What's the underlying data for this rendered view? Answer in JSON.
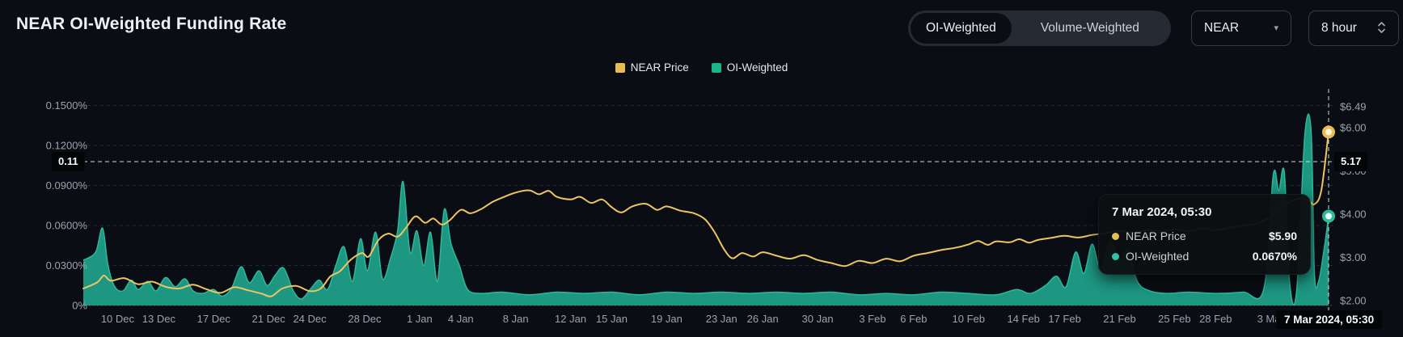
{
  "header": {
    "title": "NEAR OI-Weighted Funding Rate"
  },
  "controls": {
    "mode_toggle": {
      "options": [
        {
          "label": "OI-Weighted",
          "active": true
        },
        {
          "label": "Volume-Weighted",
          "active": false
        }
      ]
    },
    "symbol_select": {
      "value": "NEAR"
    },
    "interval_select": {
      "value": "8 hour"
    }
  },
  "legend": [
    {
      "label": "NEAR Price",
      "color": "#e9bc52"
    },
    {
      "label": "OI-Weighted",
      "color": "#19b585"
    }
  ],
  "crosshair": {
    "left_label": "0.11",
    "right_label": "5.17",
    "date_label": "7 Mar 2024, 05:30"
  },
  "tooltip": {
    "date": "7 Mar 2024, 05:30",
    "rows": [
      {
        "label": "NEAR Price",
        "value": "$5.90",
        "color": "#e5bd58"
      },
      {
        "label": "OI-Weighted",
        "value": "0.0670%",
        "color": "#35c2a4"
      }
    ]
  },
  "chart_data": {
    "type": "area+line",
    "t_unit": "days since 8 Dec 00:00; end of domain = 7 Mar 2024 05:30",
    "t_domain": [
      -0.5,
      90.23
    ],
    "left_axis": {
      "label": "OI-Weighted funding rate",
      "range": [
        0,
        0.15
      ],
      "ticks": [
        {
          "v": 0.15,
          "label": "0.1500%"
        },
        {
          "v": 0.12,
          "label": "0.1200%"
        },
        {
          "v": 0.09,
          "label": "0.0900%"
        },
        {
          "v": 0.06,
          "label": "0.0600%"
        },
        {
          "v": 0.03,
          "label": "0.0300%"
        },
        {
          "v": 0,
          "label": "0%"
        }
      ]
    },
    "right_axis": {
      "label": "NEAR price (USD)",
      "range": [
        2,
        6.49
      ],
      "ticks": [
        {
          "v": 6.49,
          "label": "$6.49"
        },
        {
          "v": 6.0,
          "label": "$6.00"
        },
        {
          "v": 5.0,
          "label": "$5.00"
        },
        {
          "v": 4.0,
          "label": "$4.00"
        },
        {
          "v": 3.0,
          "label": "$3.00"
        },
        {
          "v": 2.0,
          "label": "$2.00"
        }
      ]
    },
    "x_ticks": [
      {
        "t": 2,
        "label": "10 Dec"
      },
      {
        "t": 5,
        "label": "13 Dec"
      },
      {
        "t": 9,
        "label": "17 Dec"
      },
      {
        "t": 13,
        "label": "21 Dec"
      },
      {
        "t": 16,
        "label": "24 Dec"
      },
      {
        "t": 20,
        "label": "28 Dec"
      },
      {
        "t": 24,
        "label": "1 Jan"
      },
      {
        "t": 27,
        "label": "4 Jan"
      },
      {
        "t": 31,
        "label": "8 Jan"
      },
      {
        "t": 35,
        "label": "12 Jan"
      },
      {
        "t": 38,
        "label": "15 Jan"
      },
      {
        "t": 42,
        "label": "19 Jan"
      },
      {
        "t": 46,
        "label": "23 Jan"
      },
      {
        "t": 49,
        "label": "26 Jan"
      },
      {
        "t": 53,
        "label": "30 Jan"
      },
      {
        "t": 57,
        "label": "3 Feb"
      },
      {
        "t": 60,
        "label": "6 Feb"
      },
      {
        "t": 64,
        "label": "10 Feb"
      },
      {
        "t": 68,
        "label": "14 Feb"
      },
      {
        "t": 71,
        "label": "17 Feb"
      },
      {
        "t": 75,
        "label": "21 Feb"
      },
      {
        "t": 79,
        "label": "25 Feb"
      },
      {
        "t": 82,
        "label": "28 Feb"
      },
      {
        "t": 86,
        "label": "3 Mar"
      }
    ],
    "series": [
      {
        "name": "OI-Weighted",
        "type": "area",
        "axis": "left",
        "fill": "#1f9e88",
        "stroke": "#2db89b",
        "points": [
          [
            -0.5,
            0.034
          ],
          [
            0.4,
            0.04
          ],
          [
            0.9,
            0.058
          ],
          [
            1.3,
            0.03
          ],
          [
            1.8,
            0.014
          ],
          [
            2.4,
            0.011
          ],
          [
            3,
            0.019
          ],
          [
            3.5,
            0.012
          ],
          [
            4.2,
            0.018
          ],
          [
            4.8,
            0.011
          ],
          [
            5.5,
            0.021
          ],
          [
            6.2,
            0.014
          ],
          [
            6.9,
            0.02
          ],
          [
            7.5,
            0.011
          ],
          [
            8.2,
            0.009
          ],
          [
            9,
            0.012
          ],
          [
            9.6,
            0.007
          ],
          [
            10.3,
            0.013
          ],
          [
            11,
            0.029
          ],
          [
            11.6,
            0.017
          ],
          [
            12.3,
            0.026
          ],
          [
            12.9,
            0.015
          ],
          [
            13.5,
            0.023
          ],
          [
            14.1,
            0.028
          ],
          [
            14.8,
            0.011
          ],
          [
            15.4,
            0.005
          ],
          [
            16.1,
            0.013
          ],
          [
            16.7,
            0.019
          ],
          [
            17.3,
            0.012
          ],
          [
            17.9,
            0.03
          ],
          [
            18.5,
            0.044
          ],
          [
            19.1,
            0.018
          ],
          [
            19.7,
            0.05
          ],
          [
            20.2,
            0.026
          ],
          [
            20.8,
            0.055
          ],
          [
            21.3,
            0.02
          ],
          [
            21.9,
            0.036
          ],
          [
            22.4,
            0.056
          ],
          [
            22.8,
            0.093
          ],
          [
            23.3,
            0.04
          ],
          [
            23.8,
            0.056
          ],
          [
            24.3,
            0.03
          ],
          [
            24.8,
            0.055
          ],
          [
            25.3,
            0.018
          ],
          [
            25.8,
            0.072
          ],
          [
            26.3,
            0.046
          ],
          [
            26.9,
            0.03
          ],
          [
            27.5,
            0.012
          ],
          [
            28.5,
            0.009
          ],
          [
            30,
            0.01
          ],
          [
            32,
            0.008
          ],
          [
            34,
            0.01
          ],
          [
            36,
            0.009
          ],
          [
            38,
            0.01
          ],
          [
            40,
            0.008
          ],
          [
            42,
            0.01
          ],
          [
            44,
            0.009
          ],
          [
            46,
            0.01
          ],
          [
            48,
            0.009
          ],
          [
            50,
            0.01
          ],
          [
            52,
            0.009
          ],
          [
            54,
            0.01
          ],
          [
            56,
            0.008
          ],
          [
            58,
            0.009
          ],
          [
            60,
            0.008
          ],
          [
            62,
            0.01
          ],
          [
            64,
            0.009
          ],
          [
            66,
            0.008
          ],
          [
            67.5,
            0.012
          ],
          [
            68.5,
            0.009
          ],
          [
            69.6,
            0.015
          ],
          [
            70.4,
            0.022
          ],
          [
            71.1,
            0.014
          ],
          [
            71.8,
            0.04
          ],
          [
            72.4,
            0.024
          ],
          [
            73,
            0.046
          ],
          [
            73.6,
            0.028
          ],
          [
            74.3,
            0.048
          ],
          [
            75,
            0.034
          ],
          [
            75.6,
            0.042
          ],
          [
            76.3,
            0.018
          ],
          [
            77.2,
            0.011
          ],
          [
            78.5,
            0.009
          ],
          [
            80,
            0.01
          ],
          [
            82,
            0.009
          ],
          [
            84,
            0.01
          ],
          [
            85.5,
            0.012
          ],
          [
            86.2,
            0.098
          ],
          [
            86.6,
            0.086
          ],
          [
            87,
            0.1
          ],
          [
            87.4,
            0.016
          ],
          [
            87.9,
            0.011
          ],
          [
            88.5,
            0.128
          ],
          [
            88.95,
            0.131
          ],
          [
            89.2,
            0.024
          ],
          [
            89.5,
            0.018
          ],
          [
            89.9,
            0.042
          ],
          [
            90.23,
            0.067
          ]
        ]
      },
      {
        "name": "NEAR Price",
        "type": "line",
        "axis": "right",
        "stroke": "#edc463",
        "points": [
          [
            -0.5,
            2.28
          ],
          [
            0.5,
            2.42
          ],
          [
            1,
            2.58
          ],
          [
            1.5,
            2.46
          ],
          [
            2.5,
            2.52
          ],
          [
            3.5,
            2.38
          ],
          [
            4.5,
            2.44
          ],
          [
            5.5,
            2.32
          ],
          [
            6.5,
            2.28
          ],
          [
            7.5,
            2.37
          ],
          [
            8.5,
            2.26
          ],
          [
            9.5,
            2.18
          ],
          [
            10.5,
            2.31
          ],
          [
            11.5,
            2.24
          ],
          [
            12.5,
            2.16
          ],
          [
            13.2,
            2.1
          ],
          [
            14,
            2.28
          ],
          [
            15,
            2.34
          ],
          [
            16,
            2.22
          ],
          [
            16.8,
            2.28
          ],
          [
            17.5,
            2.56
          ],
          [
            18.2,
            2.68
          ],
          [
            19,
            2.95
          ],
          [
            19.8,
            3.1
          ],
          [
            20.3,
            3.02
          ],
          [
            21,
            3.4
          ],
          [
            21.7,
            3.55
          ],
          [
            22.4,
            3.48
          ],
          [
            23,
            3.68
          ],
          [
            23.7,
            3.95
          ],
          [
            24.4,
            3.8
          ],
          [
            25,
            3.9
          ],
          [
            25.6,
            3.76
          ],
          [
            26.2,
            3.86
          ],
          [
            27,
            4.1
          ],
          [
            27.7,
            4.02
          ],
          [
            28.5,
            4.12
          ],
          [
            29.3,
            4.28
          ],
          [
            30,
            4.38
          ],
          [
            31,
            4.5
          ],
          [
            32,
            4.55
          ],
          [
            32.7,
            4.46
          ],
          [
            33.4,
            4.54
          ],
          [
            34,
            4.4
          ],
          [
            35,
            4.34
          ],
          [
            35.7,
            4.4
          ],
          [
            36.5,
            4.26
          ],
          [
            37.3,
            4.34
          ],
          [
            38,
            4.16
          ],
          [
            38.7,
            4.04
          ],
          [
            39.5,
            4.18
          ],
          [
            40.5,
            4.24
          ],
          [
            41.3,
            4.1
          ],
          [
            42,
            4.18
          ],
          [
            43,
            4.08
          ],
          [
            44,
            4.02
          ],
          [
            44.8,
            3.88
          ],
          [
            45.5,
            3.58
          ],
          [
            46.2,
            3.18
          ],
          [
            46.8,
            2.98
          ],
          [
            47.5,
            3.1
          ],
          [
            48.3,
            3.02
          ],
          [
            49,
            3.12
          ],
          [
            50,
            3.04
          ],
          [
            51,
            2.97
          ],
          [
            52,
            3.05
          ],
          [
            53,
            2.94
          ],
          [
            54,
            2.87
          ],
          [
            55,
            2.8
          ],
          [
            56,
            2.92
          ],
          [
            57,
            2.87
          ],
          [
            58,
            2.97
          ],
          [
            59,
            2.91
          ],
          [
            60,
            3.04
          ],
          [
            61,
            3.1
          ],
          [
            62,
            3.17
          ],
          [
            63,
            3.22
          ],
          [
            64,
            3.3
          ],
          [
            64.7,
            3.38
          ],
          [
            65.4,
            3.29
          ],
          [
            66,
            3.37
          ],
          [
            67,
            3.35
          ],
          [
            67.7,
            3.42
          ],
          [
            68.4,
            3.34
          ],
          [
            69,
            3.4
          ],
          [
            70,
            3.45
          ],
          [
            71,
            3.5
          ],
          [
            72,
            3.46
          ],
          [
            73,
            3.52
          ],
          [
            74,
            3.56
          ],
          [
            75,
            3.61
          ],
          [
            76,
            3.57
          ],
          [
            77,
            3.63
          ],
          [
            78,
            3.59
          ],
          [
            79,
            3.65
          ],
          [
            80,
            3.61
          ],
          [
            81,
            3.67
          ],
          [
            82,
            3.63
          ],
          [
            83,
            3.69
          ],
          [
            84,
            3.73
          ],
          [
            85,
            3.79
          ],
          [
            86,
            3.94
          ],
          [
            86.8,
            4.14
          ],
          [
            87.5,
            4.3
          ],
          [
            88.2,
            4.37
          ],
          [
            88.8,
            4.31
          ],
          [
            89.2,
            4.23
          ],
          [
            89.7,
            4.55
          ],
          [
            90.23,
            5.9
          ]
        ]
      }
    ],
    "crosshair_point": {
      "t": 90.23,
      "price": 5.9,
      "funding": 0.067
    },
    "markers": {
      "price": {
        "fill": "#fdf3dc",
        "stroke": "#e8bd55"
      },
      "funding": {
        "fill": "#ecfdf8",
        "stroke": "#2dbd9e"
      }
    },
    "grid": "dashed"
  }
}
